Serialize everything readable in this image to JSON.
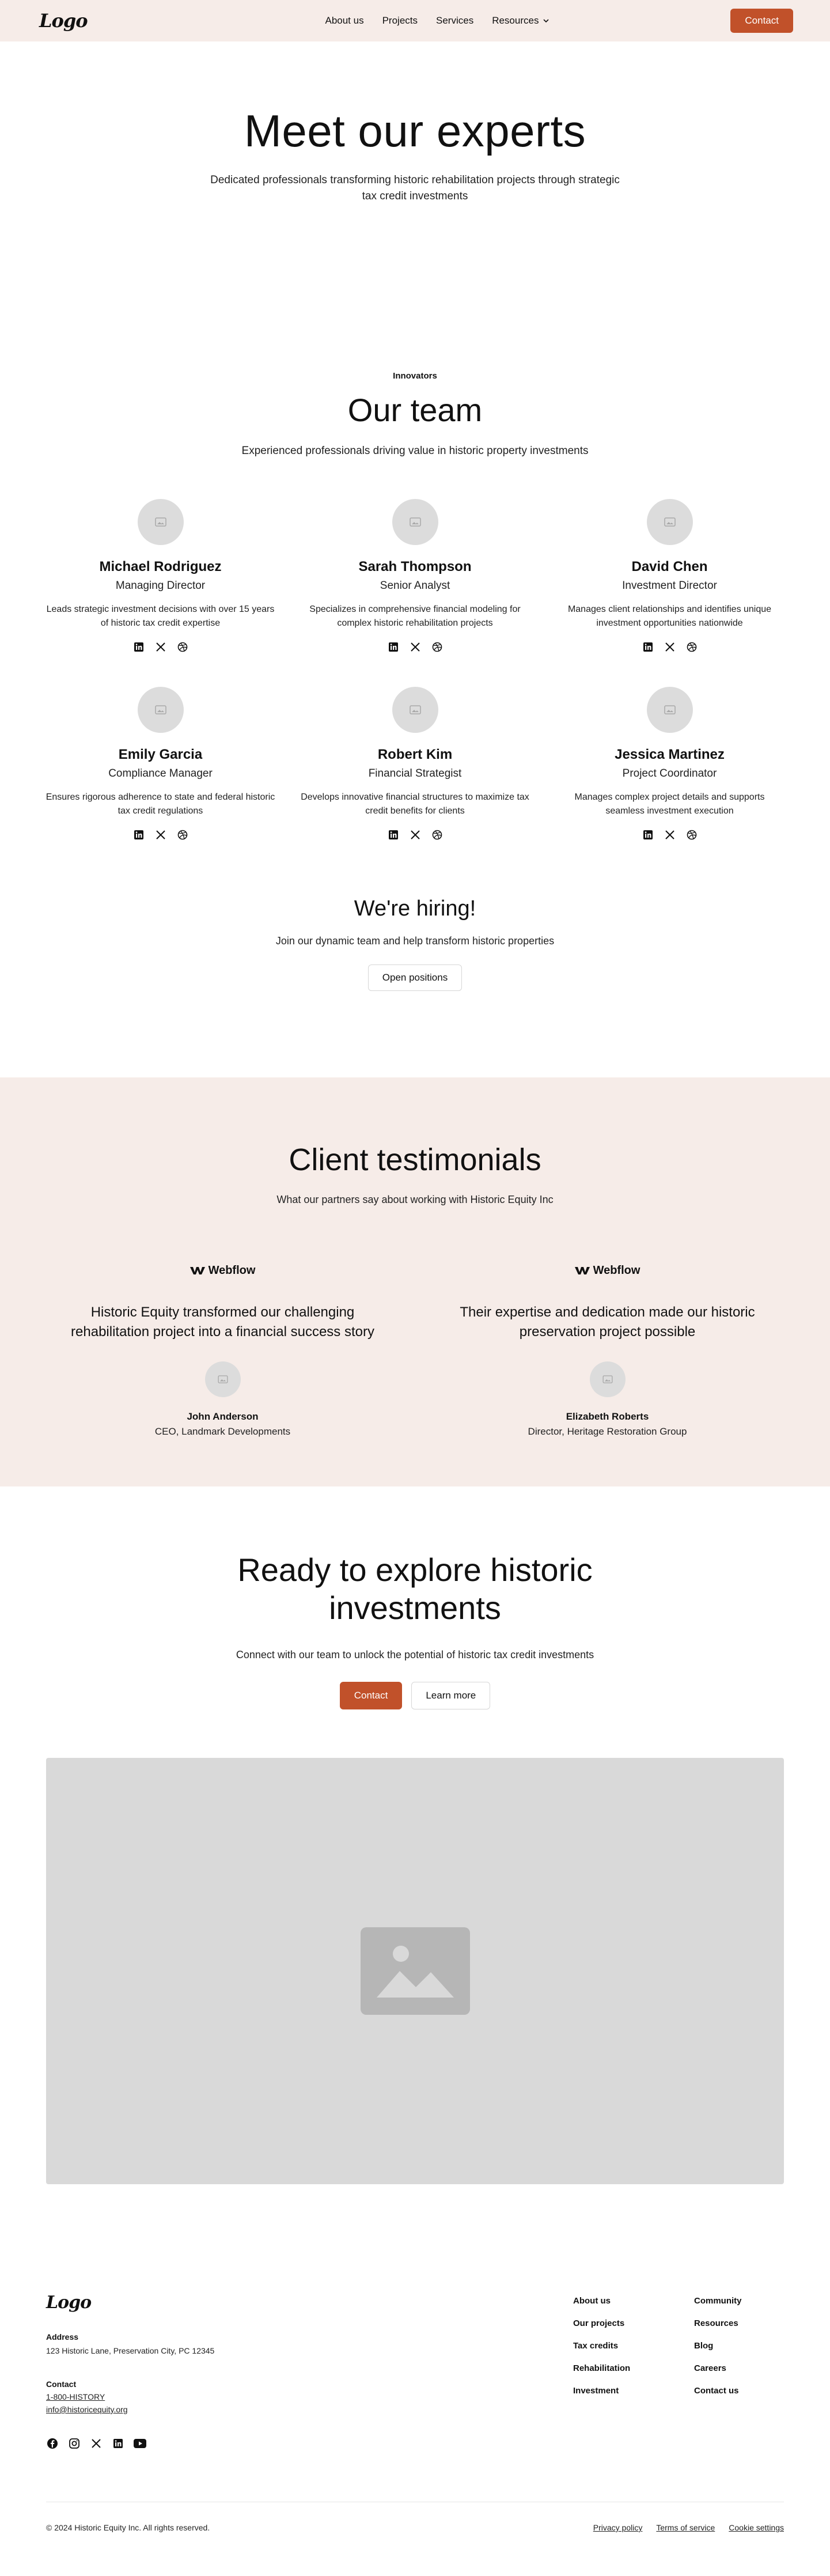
{
  "nav": {
    "logo": "Logo",
    "links": [
      "About us",
      "Projects",
      "Services",
      "Resources"
    ],
    "contact": "Contact"
  },
  "hero": {
    "title": "Meet our experts",
    "subtitle": "Dedicated professionals transforming historic rehabilitation projects through strategic tax credit investments"
  },
  "team": {
    "tagline": "Innovators",
    "title": "Our team",
    "subtitle": "Experienced professionals driving value in historic property investments",
    "members": [
      {
        "name": "Michael Rodriguez",
        "role": "Managing Director",
        "bio": "Leads strategic investment decisions with over 15 years of historic tax credit expertise"
      },
      {
        "name": "Sarah Thompson",
        "role": "Senior Analyst",
        "bio": "Specializes in comprehensive financial modeling for complex historic rehabilitation projects"
      },
      {
        "name": "David Chen",
        "role": "Investment Director",
        "bio": "Manages client relationships and identifies unique investment opportunities nationwide"
      },
      {
        "name": "Emily Garcia",
        "role": "Compliance Manager",
        "bio": "Ensures rigorous adherence to state and federal historic tax credit regulations"
      },
      {
        "name": "Robert Kim",
        "role": "Financial Strategist",
        "bio": "Develops innovative financial structures to maximize tax credit benefits for clients"
      },
      {
        "name": "Jessica Martinez",
        "role": "Project Coordinator",
        "bio": "Manages complex project details and supports seamless investment execution"
      }
    ]
  },
  "hiring": {
    "title": "We're hiring!",
    "text": "Join our dynamic team and help transform historic properties",
    "button": "Open positions"
  },
  "testimonials": {
    "title": "Client testimonials",
    "subtitle": "What our partners say about working with Historic Equity Inc",
    "items": [
      {
        "logo": "Webflow",
        "quote": "Historic Equity transformed our challenging rehabilitation project into a financial success story",
        "author": "John Anderson",
        "role": "CEO, Landmark Developments"
      },
      {
        "logo": "Webflow",
        "quote": "Their expertise and dedication made our historic preservation project possible",
        "author": "Elizabeth Roberts",
        "role": "Director, Heritage Restoration Group"
      }
    ]
  },
  "cta": {
    "title": "Ready to explore historic investments",
    "text": "Connect with our team to unlock the potential of historic tax credit investments",
    "primary": "Contact",
    "secondary": "Learn more"
  },
  "footer": {
    "logo": "Logo",
    "address_label": "Address",
    "address": "123 Historic Lane, Preservation City, PC 12345",
    "contact_label": "Contact",
    "phone": "1-800-HISTORY",
    "email": "info@historicequity.org",
    "col1": [
      "About us",
      "Our projects",
      "Tax credits",
      "Rehabilitation",
      "Investment"
    ],
    "col2": [
      "Community",
      "Resources",
      "Blog",
      "Careers",
      "Contact us"
    ],
    "copyright": "© 2024 Historic Equity Inc. All rights reserved.",
    "legal": [
      "Privacy policy",
      "Terms of service",
      "Cookie settings"
    ]
  },
  "colors": {
    "accent": "#c1512a",
    "tint": "#f6ece8",
    "placeholder": "#d9d9d9"
  }
}
